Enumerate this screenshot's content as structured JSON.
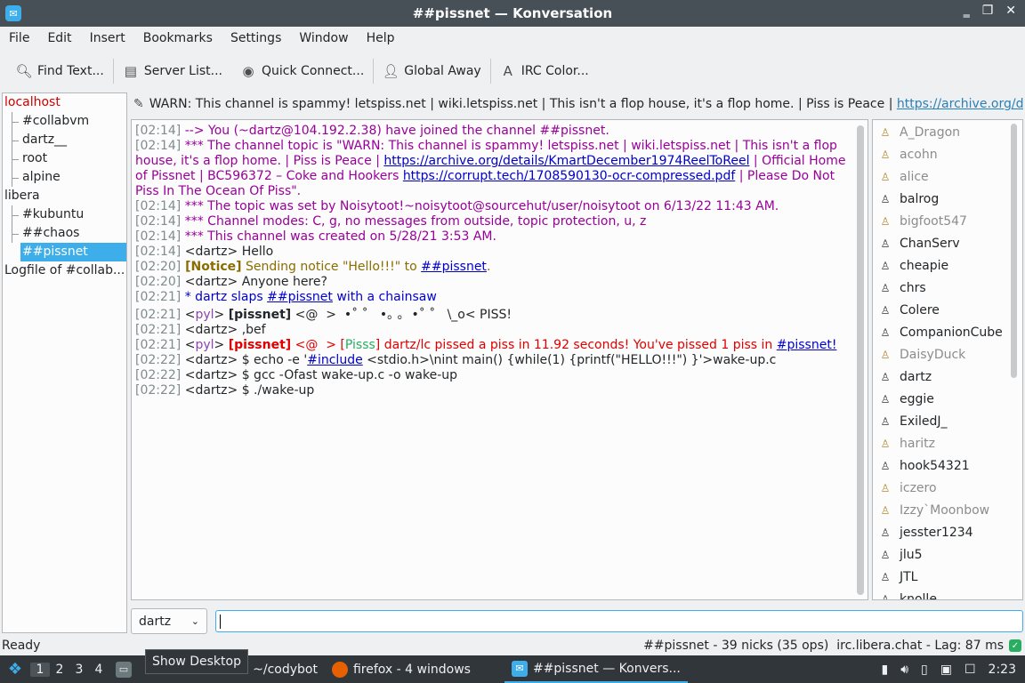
{
  "window": {
    "title": "##pissnet — Konversation"
  },
  "menu": [
    "File",
    "Edit",
    "Insert",
    "Bookmarks",
    "Settings",
    "Window",
    "Help"
  ],
  "toolbar": {
    "find": "Find Text...",
    "server_list": "Server List...",
    "quick_connect": "Quick Connect...",
    "global_away": "Global Away",
    "irc_color": "IRC Color..."
  },
  "tree": [
    {
      "label": "localhost",
      "type": "server",
      "color": "#d10000"
    },
    {
      "label": "#collabvm",
      "type": "child"
    },
    {
      "label": "dartz__",
      "type": "child"
    },
    {
      "label": "root",
      "type": "child"
    },
    {
      "label": "alpine",
      "type": "child"
    },
    {
      "label": "libera",
      "type": "server"
    },
    {
      "label": "#kubuntu",
      "type": "child"
    },
    {
      "label": "##chaos",
      "type": "child"
    },
    {
      "label": "##pissnet",
      "type": "child",
      "selected": true
    },
    {
      "label": "Logfile of #collab...",
      "type": "server"
    }
  ],
  "topic": {
    "text": "WARN: This channel is spammy! letspiss.net | wiki.letspiss.net | This isn't a flop house, it's a flop home. | Piss is Peace | ",
    "link": "https://archive.org/det..."
  },
  "messages": {
    "m1": {
      "ts": "[02:14]",
      "text": " --> You (~dartz@104.192.2.38) have joined the channel ##pissnet."
    },
    "m2": {
      "ts": "[02:14]",
      "pre": " *** The channel topic is \"WARN: This channel is spammy! letspiss.net | wiki.letspiss.net | This isn't a flop house, it's a flop home. | Piss is Peace | ",
      "link1": "https://archive.org/details/KmartDecember1974ReelToReel",
      "mid": " | Official Home of Pissnet | BC596372 – Coke and Hookers ",
      "link2": "https://corrupt.tech/1708590130-ocr-compressed.pdf",
      "post": " | Please Do Not Piss In The Ocean Of Piss\"."
    },
    "m3": {
      "ts": "[02:14]",
      "text": " *** The topic was set by Noisytoot!~noisytoot@sourcehut/user/noisytoot on 6/13/22 11:43 AM."
    },
    "m4": {
      "ts": "[02:14]",
      "text": " *** Channel modes: C, g, no messages from outside, topic protection, u, z"
    },
    "m5": {
      "ts": "[02:14]",
      "text": " *** This channel was created on 5/28/21 3:53 AM."
    },
    "m6": {
      "ts": "[02:14]",
      "text": " <dartz> Hello"
    },
    "m7": {
      "ts": "[02:20]",
      "tag": " [Notice]",
      "text": " Sending notice \"Hello!!!\" to ",
      "link": "##pissnet",
      "end": "."
    },
    "m8": {
      "ts": "[02:20]",
      "text": " <dartz> Anyone here?"
    },
    "m9": {
      "ts": "[02:21]",
      "pre": " * dartz ",
      "verb": "slaps",
      "sp": " ",
      "link": "##pissnet",
      "post": " with a chainsaw"
    },
    "m10": {
      "ts": "[02:21]",
      "open": " <",
      "nick": "pyl",
      "close": "> ",
      "bracket": "[pissnet]",
      "text": " <@  >  •˚ ˚   •｡ ｡  •˚ ˚   \\_o< PISS!"
    },
    "m11": {
      "ts": "[02:21]",
      "text": " <dartz> ,bef"
    },
    "m12": {
      "ts": "[02:21]",
      "open": " <",
      "nick": "pyl",
      "close": "> ",
      "bracket": "[pissnet]",
      "face": " <@  > ",
      "tag_open": "[",
      "tag": "Pisss",
      "tag_close": "]",
      "text": " dartz/lc pissed a piss in 11.92 seconds! You've pissed 1 piss in ",
      "link": "#pissnet!"
    },
    "m13": {
      "ts": "[02:22]",
      "pre": " <dartz> $ echo -e '",
      "link": "#include",
      "post": " <stdio.h>\\nint main() {while(1) {printf(\"HELLO!!!\") }'>wake-up.c"
    },
    "m14": {
      "ts": "[02:22]",
      "text": " <dartz> $ gcc -Ofast wake-up.c -o wake-up"
    },
    "m15": {
      "ts": "[02:22]",
      "text": " <dartz> $ ./wake-up"
    }
  },
  "nicks": [
    {
      "name": "A_Dragon",
      "away": true
    },
    {
      "name": "acohn",
      "away": true
    },
    {
      "name": "alice",
      "away": true
    },
    {
      "name": "balrog",
      "away": false
    },
    {
      "name": "bigfoot547",
      "away": true
    },
    {
      "name": "ChanServ",
      "away": false
    },
    {
      "name": "cheapie",
      "away": false
    },
    {
      "name": "chrs",
      "away": false
    },
    {
      "name": "Colere",
      "away": false
    },
    {
      "name": "CompanionCube",
      "away": false
    },
    {
      "name": "DaisyDuck",
      "away": true
    },
    {
      "name": "dartz",
      "away": false
    },
    {
      "name": "eggie",
      "away": false
    },
    {
      "name": "ExiledJ_",
      "away": false
    },
    {
      "name": "haritz",
      "away": true
    },
    {
      "name": "hook54321",
      "away": false
    },
    {
      "name": "iczero",
      "away": true
    },
    {
      "name": "Izzy`Moonbow",
      "away": true
    },
    {
      "name": "jesster1234",
      "away": false
    },
    {
      "name": "jlu5",
      "away": false
    },
    {
      "name": "JTL",
      "away": false
    },
    {
      "name": "knolle",
      "away": false
    }
  ],
  "input": {
    "nick": "dartz",
    "value": ""
  },
  "status": {
    "left": "Ready",
    "right": "##pissnet - 39 nicks (35 ops)  irc.libera.chat - Lag: 87 ms"
  },
  "taskbar": {
    "desktops": [
      "1",
      "2",
      "3",
      "4"
    ],
    "tooltip": "Show Desktop",
    "app_terminal": "M3: ~/codybot",
    "app_firefox": "firefox - 4 windows",
    "app_konversation": "##pissnet — Konvers...",
    "clock": "2:23"
  }
}
